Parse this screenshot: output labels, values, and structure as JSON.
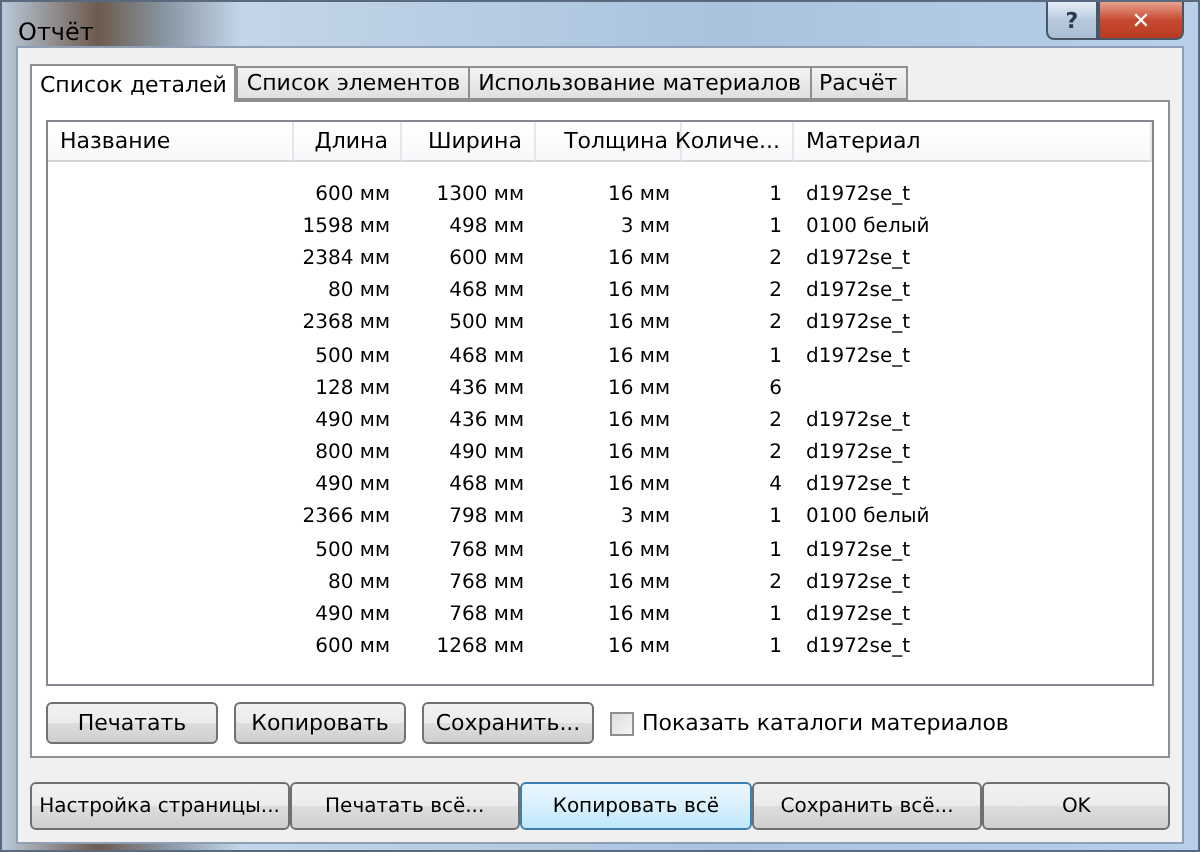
{
  "window": {
    "title": "Отчёт"
  },
  "title_buttons": [
    {
      "kind": "help",
      "label": "?"
    },
    {
      "kind": "close",
      "label": "✕"
    }
  ],
  "tabs": [
    {
      "label": "Список деталей",
      "selected": true
    },
    {
      "label": "Список элементов",
      "selected": false
    },
    {
      "label": "Использование материалов",
      "selected": false
    },
    {
      "label": "Расчёт",
      "selected": false
    }
  ],
  "table": {
    "columns": [
      {
        "label": "Название"
      },
      {
        "label": "Длина"
      },
      {
        "label": "Ширина"
      },
      {
        "label": "Толщина"
      },
      {
        "label": "Количе..."
      },
      {
        "label": "Материал"
      }
    ],
    "rows": [
      [
        "",
        "600 мм",
        "1300 мм",
        "16 мм",
        "1",
        "d1972se_t"
      ],
      [
        "",
        "1598 мм",
        "498 мм",
        "3 мм",
        "1",
        "0100 белый"
      ],
      [
        "",
        "2384 мм",
        "600 мм",
        "16 мм",
        "2",
        "d1972se_t"
      ],
      [
        "",
        "80 мм",
        "468 мм",
        "16 мм",
        "2",
        "d1972se_t"
      ],
      [
        "",
        "2368 мм",
        "500 мм",
        "16 мм",
        "2",
        "d1972se_t"
      ],
      [
        "",
        "500 мм",
        "468 мм",
        "16 мм",
        "1",
        "d1972se_t"
      ],
      [
        "",
        "128 мм",
        "436 мм",
        "16 мм",
        "6",
        ""
      ],
      [
        "",
        "490 мм",
        "436 мм",
        "16 мм",
        "2",
        "d1972se_t"
      ],
      [
        "",
        "800 мм",
        "490 мм",
        "16 мм",
        "2",
        "d1972se_t"
      ],
      [
        "",
        "490 мм",
        "468 мм",
        "16 мм",
        "4",
        "d1972se_t"
      ],
      [
        "",
        "2366 мм",
        "798 мм",
        "3 мм",
        "1",
        "0100 белый"
      ],
      [
        "",
        "500 мм",
        "768 мм",
        "16 мм",
        "1",
        "d1972se_t"
      ],
      [
        "",
        "80 мм",
        "768 мм",
        "16 мм",
        "2",
        "d1972se_t"
      ],
      [
        "",
        "490 мм",
        "768 мм",
        "16 мм",
        "1",
        "d1972se_t"
      ],
      [
        "",
        "600 мм",
        "1268 мм",
        "16 мм",
        "1",
        "d1972se_t"
      ]
    ]
  },
  "panel_buttons": [
    {
      "label": "Печатать"
    },
    {
      "label": "Копировать"
    },
    {
      "label": "Сохранить..."
    }
  ],
  "show_catalogs": {
    "label": "Показать каталоги материалов",
    "checked": false
  },
  "footer_buttons": [
    {
      "label": "Настройка страницы...",
      "hovered": false
    },
    {
      "label": "Печатать всё...",
      "hovered": false
    },
    {
      "label": "Копировать всё",
      "hovered": true
    },
    {
      "label": "Сохранить всё...",
      "hovered": false
    },
    {
      "label": "OK",
      "hovered": false
    }
  ]
}
